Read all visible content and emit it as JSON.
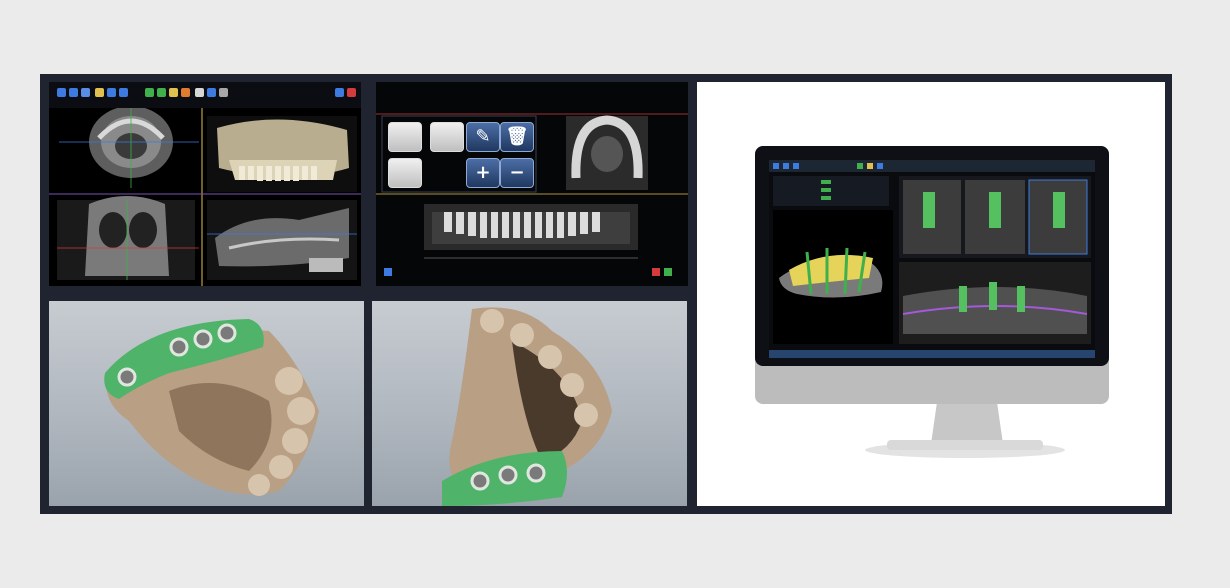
{
  "panels": {
    "ct": {
      "toolbar_icon_colors": [
        "#3d7be0",
        "#3d7be0",
        "#3d7be0",
        "#e0c14f",
        "#3d7be0",
        "#3fb04b",
        "#e07b2f",
        "#d23c3c",
        "#3d7be0",
        "#a7a7a7",
        "#3d7be0",
        "#3d7be0"
      ]
    },
    "pano": {
      "add_glyph": "+",
      "remove_glyph": "−"
    },
    "monitor": {
      "os": "desktop monitor"
    }
  }
}
